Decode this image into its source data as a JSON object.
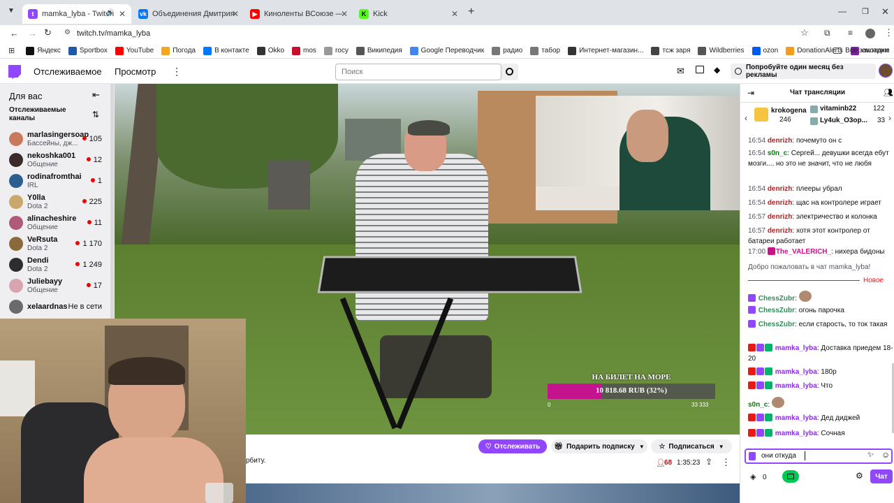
{
  "browser": {
    "tabs": [
      {
        "title": "mamka_lyba - Twitch",
        "fav": "#9146ff"
      },
      {
        "title": "Объединения Дмитрия Зорин",
        "fav": "#0077ff"
      },
      {
        "title": "Киноленты ВСоюзе — смотре",
        "fav": "#ff0000"
      },
      {
        "title": "Kick",
        "fav": "#53fc18"
      }
    ],
    "url": "twitch.tv/mamka_lyba",
    "bookmarks": [
      {
        "label": "Яндекс",
        "color": "#111"
      },
      {
        "label": "Sportbox",
        "color": "#1e5aa8"
      },
      {
        "label": "YouTube",
        "color": "#ff0000"
      },
      {
        "label": "Погода",
        "color": "#f5a623"
      },
      {
        "label": "В контакте",
        "color": "#0077ff"
      },
      {
        "label": "Okko",
        "color": "#333"
      },
      {
        "label": "mos",
        "color": "#c8102e"
      },
      {
        "label": "rocy",
        "color": "#999"
      },
      {
        "label": "Википедия",
        "color": "#555"
      },
      {
        "label": "Google Переводчик",
        "color": "#4285f4"
      },
      {
        "label": "радио",
        "color": "#777"
      },
      {
        "label": "табор",
        "color": "#777"
      },
      {
        "label": "Интернет-магазин...",
        "color": "#333"
      },
      {
        "label": "тсж заря",
        "color": "#444"
      },
      {
        "label": "Wildberries",
        "color": "#555"
      },
      {
        "label": "ozon",
        "color": "#005bff"
      },
      {
        "label": "DonationAlerts",
        "color": "#f59c1a"
      },
      {
        "label": "смотрим",
        "color": "#7b1fa2"
      },
      {
        "label": "Циан",
        "color": "#0468ff"
      }
    ],
    "all_bookmarks": "Все закладки"
  },
  "header": {
    "following": "Отслеживаемое",
    "browse": "Просмотр",
    "search_placeholder": "Поиск",
    "promo": "Попробуйте один месяц без рекламы"
  },
  "sidebar": {
    "for_you": "Для вас",
    "followed": "Отслеживаемые каналы",
    "channels": [
      {
        "name": "marlasingersoap",
        "game": "Бассейны, дж...",
        "viewers": "105",
        "color": "#c97a5a"
      },
      {
        "name": "nekoshka001",
        "game": "Общение",
        "viewers": "12",
        "color": "#3b2b2b"
      },
      {
        "name": "rodinafromthai",
        "game": "IRL",
        "viewers": "1",
        "color": "#2a5f8f"
      },
      {
        "name": "Y0lla",
        "game": "Dota 2",
        "viewers": "225",
        "color": "#caa76a"
      },
      {
        "name": "alinacheshire",
        "game": "Общение",
        "viewers": "11",
        "color": "#b05a7a"
      },
      {
        "name": "VeRsuta",
        "game": "Dota 2",
        "viewers": "1 170",
        "color": "#8a6a3a"
      },
      {
        "name": "Dendi",
        "game": "Dota 2",
        "viewers": "1 249",
        "color": "#2d2d2d"
      },
      {
        "name": "Juliebayy",
        "game": "Общение",
        "viewers": "17",
        "color": "#d8a4b0"
      },
      {
        "name": "xelaardnas",
        "game": "",
        "viewers": "Не в сети",
        "color": "#6a6a6a"
      }
    ]
  },
  "video": {
    "goal_title": "НА БИЛЕТ НА МОРЕ",
    "goal_amount": "10 818.68 RUB (32%)",
    "goal_progress": 0.32,
    "goal_min": "0",
    "goal_max": "33 333"
  },
  "stream_info": {
    "title_fragment": "рбиту.",
    "follow": "Отслеживать",
    "gift": "Подарить подписку",
    "subscribe": "Подписаться",
    "viewers": "68",
    "uptime": "1:35:23"
  },
  "chat": {
    "title": "Чат трансляции",
    "top": [
      {
        "name": "krokogena",
        "value": "246"
      },
      {
        "name": "vitaminb22",
        "value": "122"
      },
      {
        "name": "Ly4uk_O3op...",
        "value": "33"
      }
    ],
    "messages_top": [
      {
        "time": "16:54",
        "user": "denrizh",
        "color": "#b22222",
        "text": "почемуто он с"
      },
      {
        "time": "16:54",
        "user": "s0n_c",
        "color": "#008000",
        "text": "Сергей... девушки всегда ебут мозги.... но это не значит, что не любя"
      },
      {
        "time": "16:54",
        "user": "denrizh",
        "color": "#b22222",
        "text": "плееры убрал"
      },
      {
        "time": "16:54",
        "user": "denrizh",
        "color": "#b22222",
        "text": "щас на контролере играет"
      },
      {
        "time": "16:57",
        "user": "denrizh",
        "color": "#b22222",
        "text": "электричество и колонка"
      },
      {
        "time": "16:57",
        "user": "denrizh",
        "color": "#b22222",
        "text": "хотя этот контролер от батареи работает"
      },
      {
        "time": "17:00",
        "user": "The_VALERICH_",
        "color": "#c71585",
        "text": "нихера бидоны"
      }
    ],
    "welcome": "Добро пожаловать в чат mamka_lyba!",
    "new_label": "Новое",
    "messages_bottom": [
      {
        "user": "ChessZubr",
        "color": "#2e8b57",
        "text": ""
      },
      {
        "user": "ChessZubr",
        "color": "#2e8b57",
        "text": "огонь парочка"
      },
      {
        "user": "ChessZubr",
        "color": "#2e8b57",
        "text": "если старость, то ток такая"
      },
      {
        "user": "mamka_lyba",
        "color": "#8a2be2",
        "text": "Доставка приедем 18-20"
      },
      {
        "user": "mamka_lyba",
        "color": "#8a2be2",
        "text": "180р"
      },
      {
        "user": "mamka_lyba",
        "color": "#8a2be2",
        "text": "Что"
      },
      {
        "user": "s0n_c",
        "color": "#008000",
        "text": ""
      },
      {
        "user": "mamka_lyba",
        "color": "#8a2be2",
        "text": "Дед диджей"
      },
      {
        "user": "mamka_lyba",
        "color": "#8a2be2",
        "text": "Сочная"
      }
    ],
    "input_value": "они откуда",
    "points": "0",
    "send": "Чат"
  }
}
